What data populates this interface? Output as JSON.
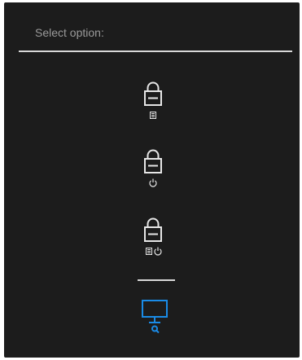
{
  "header": {
    "prompt": "Select option:"
  },
  "options": [
    {
      "icon": "lock-icon",
      "sub_icons": [
        "menu-icon"
      ]
    },
    {
      "icon": "lock-icon",
      "sub_icons": [
        "power-icon"
      ]
    },
    {
      "icon": "lock-icon",
      "sub_icons": [
        "menu-icon",
        "power-icon"
      ]
    },
    {
      "icon": "monitor-diagnostics-icon",
      "selected": true
    }
  ],
  "colors": {
    "background": "#1c1c1c",
    "prompt_text": "#9a9a9a",
    "icon": "#e6e6e6",
    "divider": "#d8d8d8",
    "selected_accent": "#1a8be6"
  }
}
